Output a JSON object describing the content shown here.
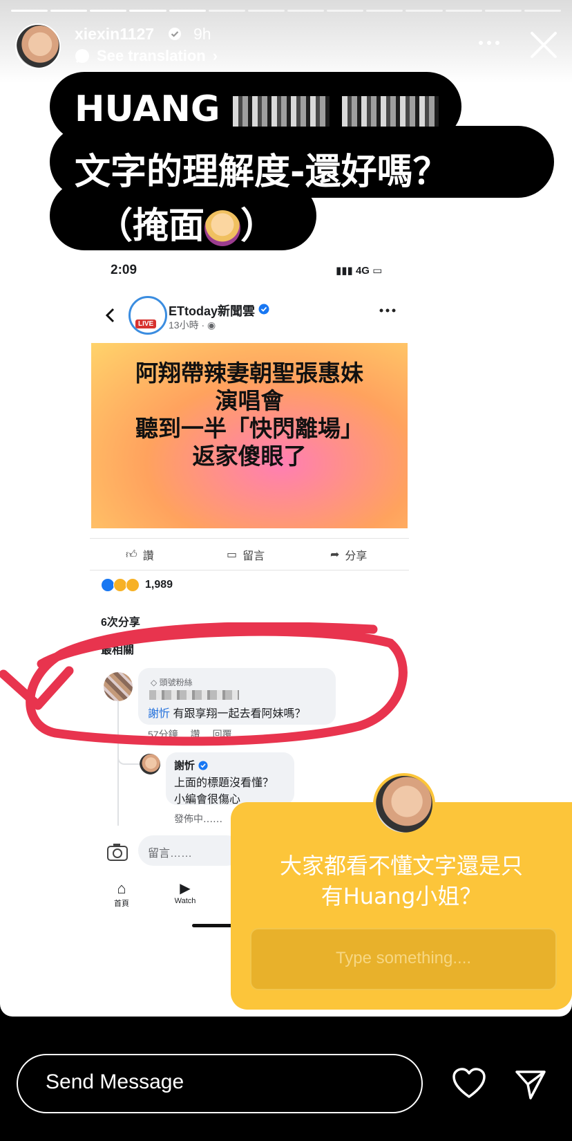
{
  "header": {
    "username": "xiexin1127",
    "age": "9h",
    "translate_label": "See translation",
    "progress_segments": 14,
    "progress_done": 5
  },
  "caption": {
    "line1": "HUANG",
    "line2": "文字的理解度-還好嗎？",
    "line3_open": "（掩面",
    "line3_close": "）"
  },
  "fb": {
    "status_time": "2:09",
    "network": "4G",
    "page_name": "ETtoday新聞雲",
    "live_badge": "LIVE",
    "post_time": "13小時 ·",
    "image_text": [
      "阿翔帶辣妻朝聖張惠妹",
      "演唱會",
      "聽到一半「快閃離場」",
      "返家傻眼了"
    ],
    "like_label": "讚",
    "comment_label": "留言",
    "share_label": "分享",
    "reaction_count": "1,989",
    "shares_text": "6次分享",
    "section_cut": "最相關",
    "comment": {
      "badge": "頭號粉絲",
      "mention": "謝忻",
      "text": " 有跟享翔一起去看阿妹嗎？",
      "time": "57分鐘",
      "like": "讚",
      "reply": "回覆"
    },
    "reply": {
      "name": "謝忻",
      "line1": "上面的標題沒看懂？",
      "line2": "小編會很傷心",
      "sending": "發佈中‥‥‥"
    },
    "input_placeholder": "留言……",
    "nav_home": "首頁",
    "nav_watch": "Watch"
  },
  "question": {
    "text_line1": "大家都看不懂文字還是只",
    "text_line2": "有Huang小姐？",
    "placeholder": "Type something...."
  },
  "bottom": {
    "message_placeholder": "Send Message"
  },
  "colors": {
    "sticker": "#fcc53a",
    "red_marker": "#e8344e",
    "fb_blue": "#1877f2"
  }
}
